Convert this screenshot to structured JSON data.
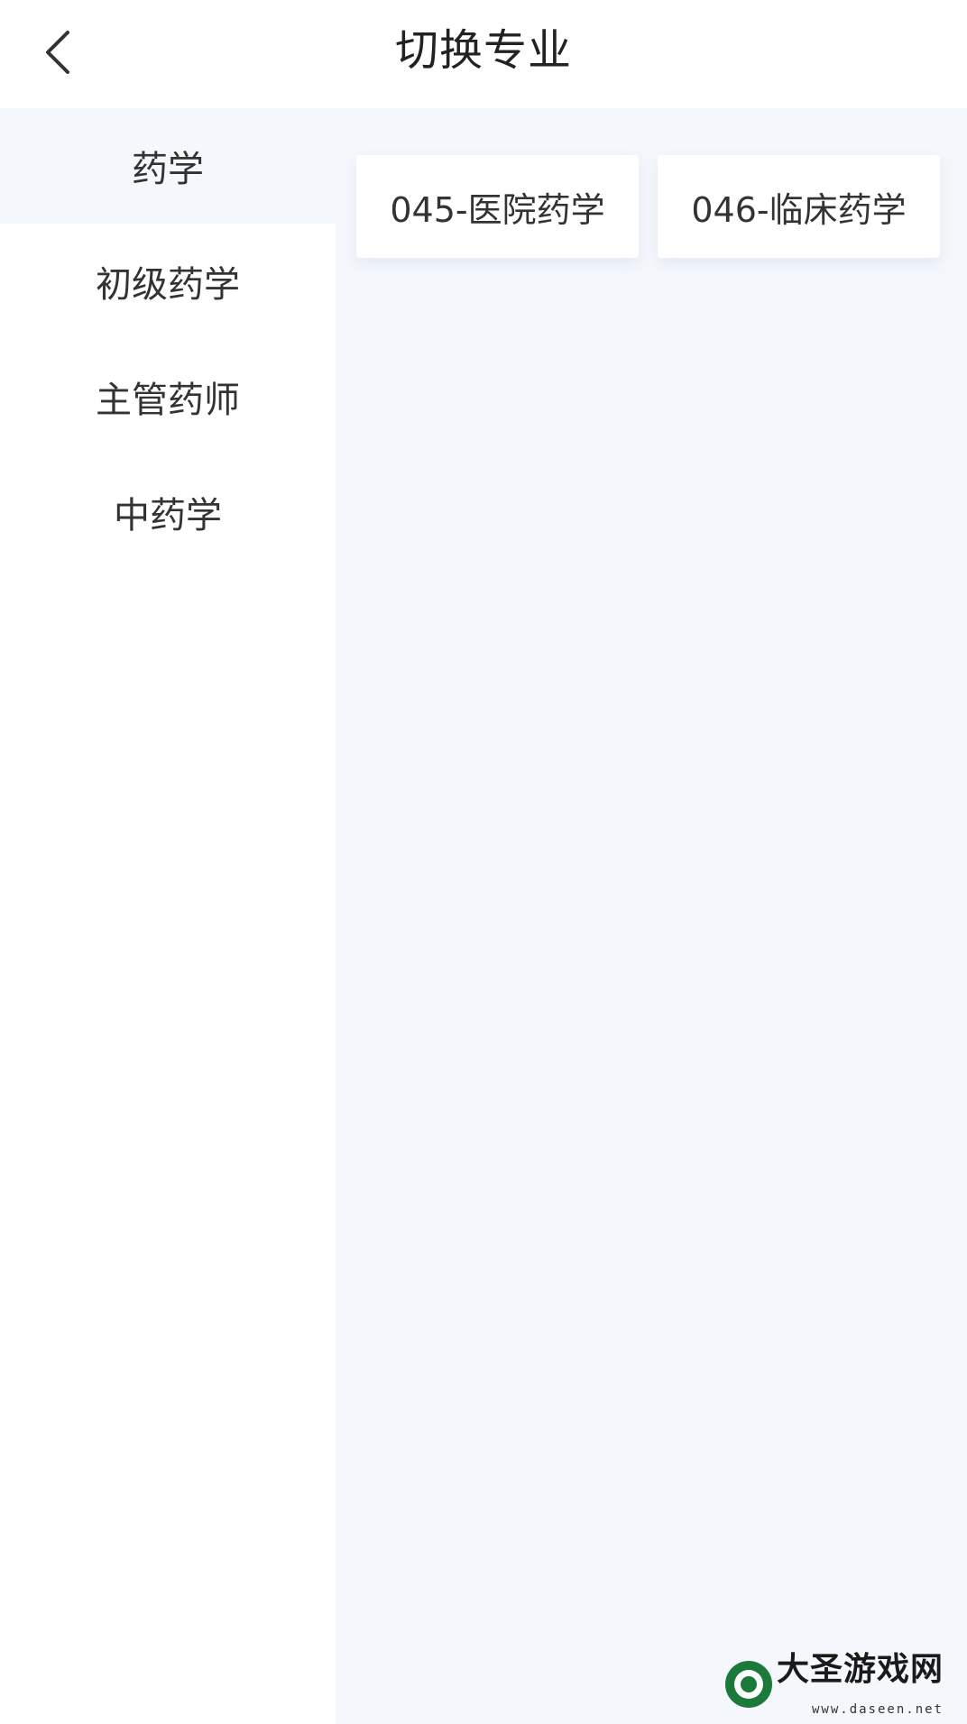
{
  "header": {
    "title": "切换专业"
  },
  "sidebar": {
    "items": [
      {
        "label": "药学",
        "active": true
      },
      {
        "label": "初级药学",
        "active": false
      },
      {
        "label": "主管药师",
        "active": false
      },
      {
        "label": "中药学",
        "active": false
      }
    ]
  },
  "content": {
    "cards": [
      {
        "label": "045-医院药学"
      },
      {
        "label": "046-临床药学"
      }
    ]
  },
  "watermark": {
    "text": "大圣游戏网",
    "url": "www.daseen.net"
  },
  "colors": {
    "background": "#ffffff",
    "panel": "#f4f7fc",
    "text": "#333333",
    "title": "#222222"
  }
}
